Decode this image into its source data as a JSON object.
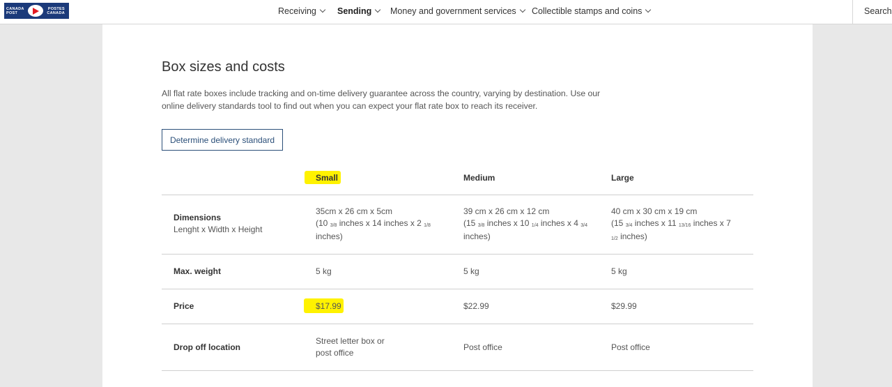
{
  "logo": {
    "left_text": [
      "CANADA",
      "POST"
    ],
    "right_text": [
      "POSTES",
      "CANADA"
    ]
  },
  "nav": {
    "items": [
      {
        "label": "Receiving"
      },
      {
        "label": "Sending"
      },
      {
        "label": "Money and government services"
      },
      {
        "label": "Collectible stamps and coins"
      }
    ],
    "search_label": "Search"
  },
  "page": {
    "title": "Box sizes and costs",
    "intro": "All flat rate boxes include tracking and on-time delivery guarantee across the country, varying by destination. Use our online delivery standards tool to find out when you can expect your flat rate box to reach its receiver.",
    "button_label": "Determine delivery standard"
  },
  "table": {
    "columns": [
      "Small",
      "Medium",
      "Large"
    ],
    "rows": {
      "dimensions": {
        "label": "Dimensions",
        "sublabel": "Lenght x Width x Height",
        "small": {
          "metric": "35cm x 26 cm x 5cm",
          "imp_a": "(10 ",
          "frac1": "3/8",
          "imp_b": " inches x 14 inches x 2 ",
          "frac2": "1/8",
          "imp_c": "inches)"
        },
        "medium": {
          "metric": "39 cm x 26 cm x 12 cm",
          "imp_a": "(15 ",
          "frac1": "3/8",
          "imp_b": " inches x 10 ",
          "frac2": "1/4",
          "imp_c": " inches x 4 ",
          "frac3": "3/4",
          "imp_d": "inches)"
        },
        "large": {
          "metric": "40 cm x 30 cm x 19 cm",
          "imp_a": "(15 ",
          "frac1": "3/4",
          "imp_b": " inches x 11 ",
          "frac2": "13/16",
          "imp_c": " inches x 7",
          "frac3": "1/2",
          "imp_d": " inches)"
        }
      },
      "weight": {
        "label": "Max. weight",
        "small": "5 kg",
        "medium": "5 kg",
        "large": "5 kg"
      },
      "price": {
        "label": "Price",
        "small": "$17.99",
        "medium": "$22.99",
        "large": "$29.99"
      },
      "dropoff": {
        "label": "Drop off location",
        "small_1": "Street letter box or",
        "small_2": "post office",
        "medium": "Post office",
        "large": "Post office"
      }
    }
  },
  "highlight_color": "#fff200",
  "accent_color": "#2b4f79"
}
